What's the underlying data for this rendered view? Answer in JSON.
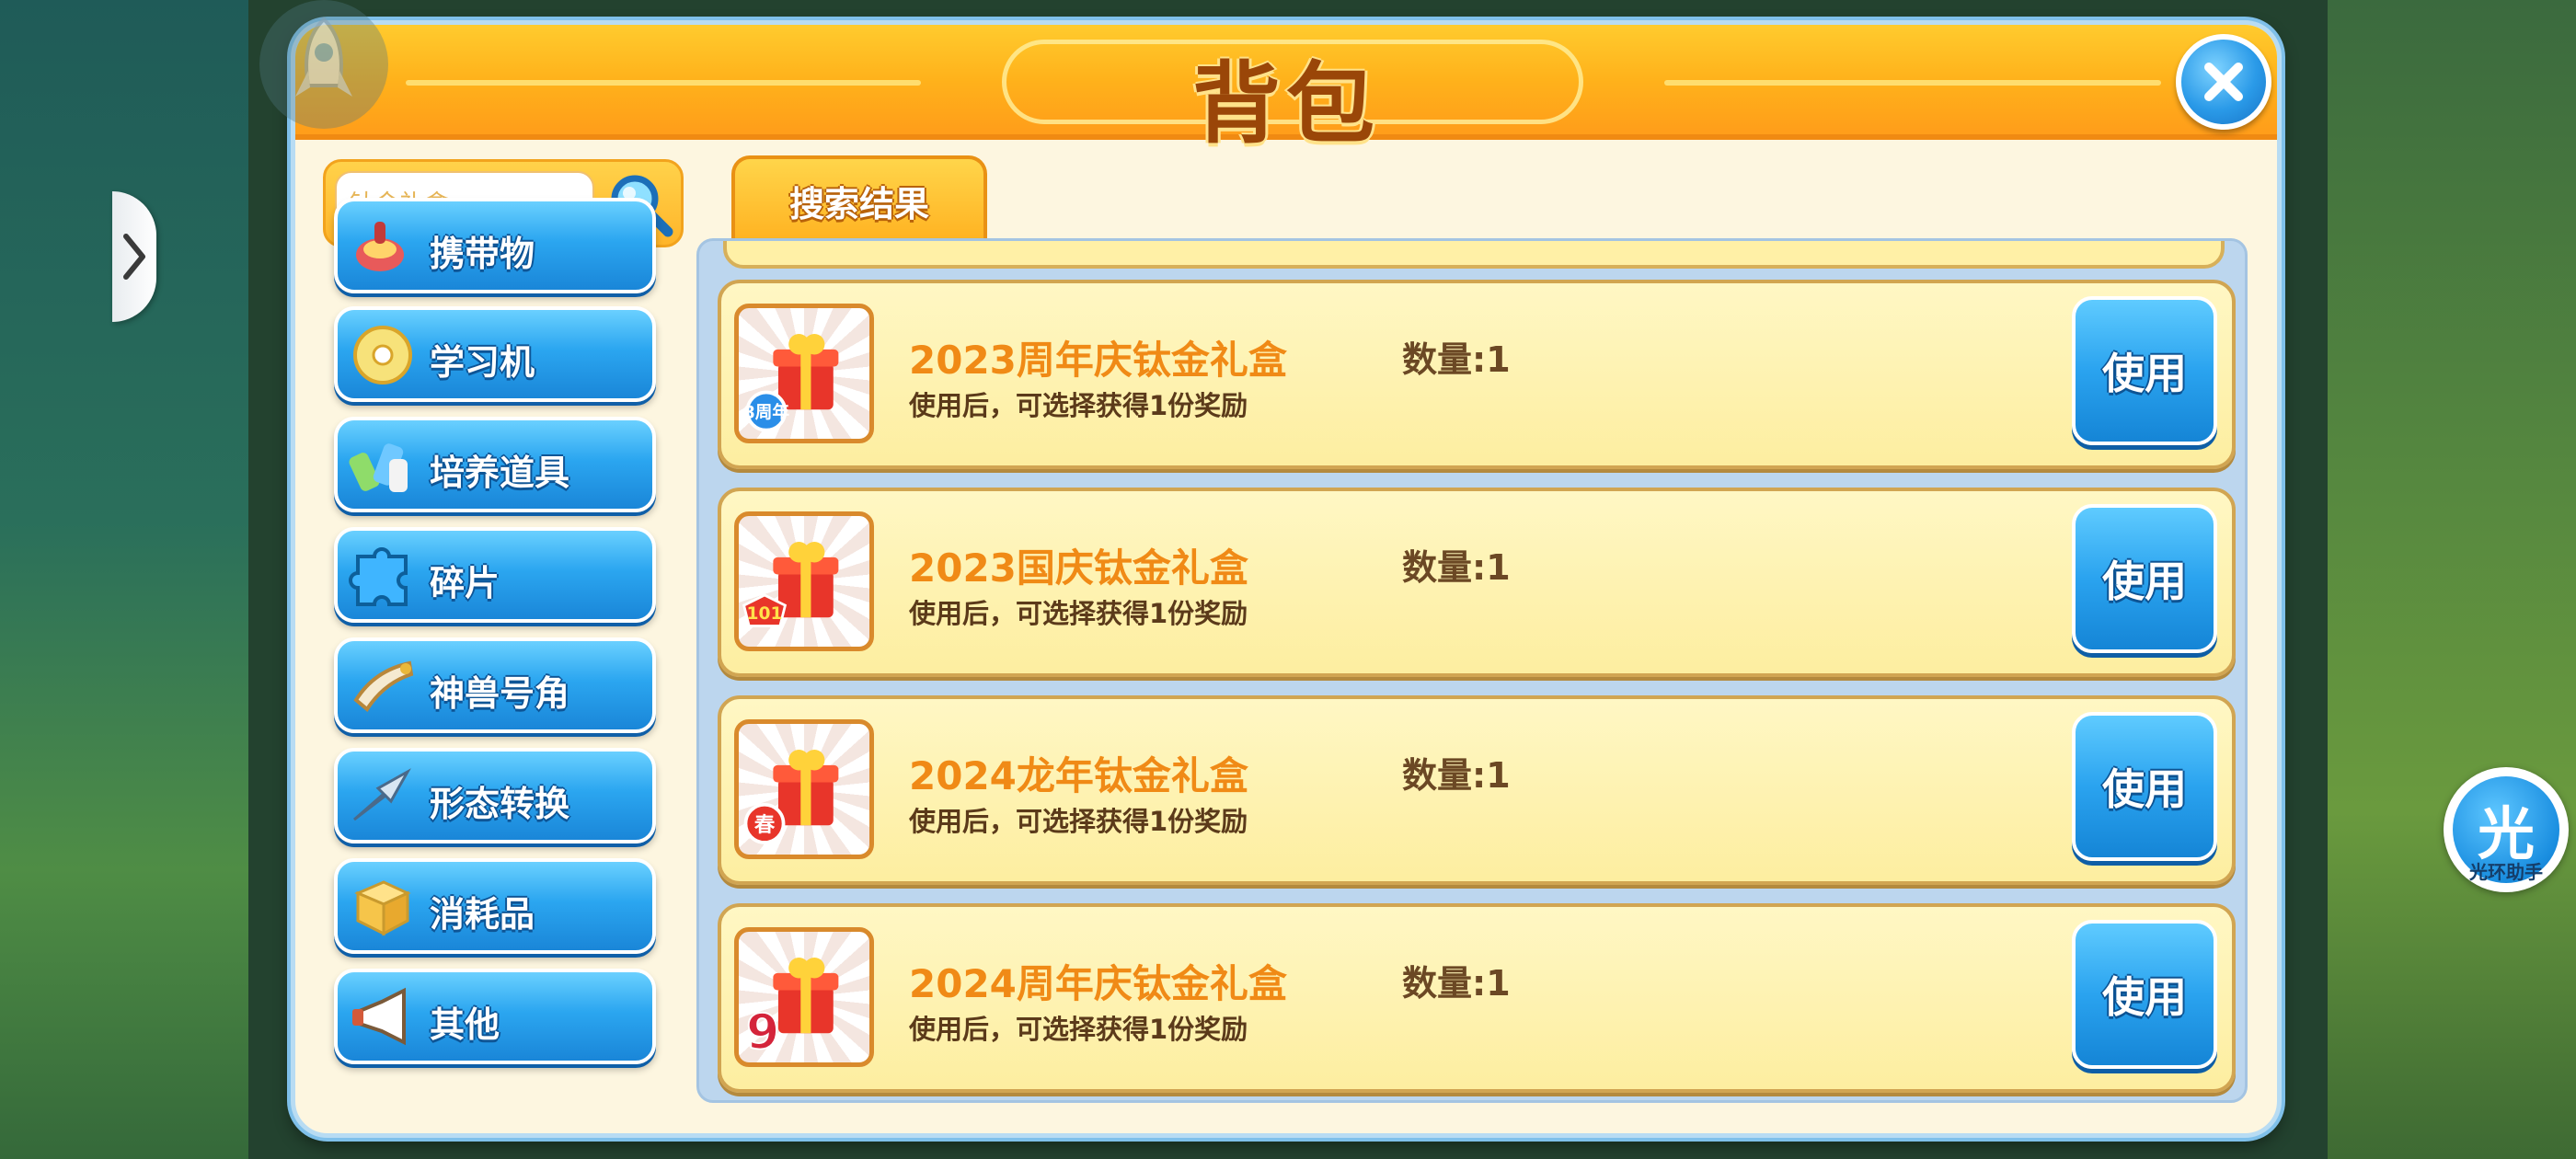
{
  "window": {
    "title": "背包"
  },
  "colors": {
    "title_bar": "#ffb21b",
    "panel_bg": "#fdf6e0",
    "category_button": "#2ba6f0",
    "item_name": "#f08a16",
    "use_button": "#2aa3ef"
  },
  "search": {
    "placeholder": "钛金礼盒",
    "value": ""
  },
  "sidebar": {
    "categories": [
      {
        "label": "携带物",
        "icon": "carry-item-icon"
      },
      {
        "label": "学习机",
        "icon": "disc-icon"
      },
      {
        "label": "培养道具",
        "icon": "potion-icon"
      },
      {
        "label": "碎片",
        "icon": "puzzle-piece-icon"
      },
      {
        "label": "神兽号角",
        "icon": "horn-icon"
      },
      {
        "label": "形态转换",
        "icon": "arrow-shift-icon"
      },
      {
        "label": "消耗品",
        "icon": "box-icon"
      },
      {
        "label": "其他",
        "icon": "megaphone-icon"
      }
    ]
  },
  "tabs": [
    {
      "label": "搜索结果",
      "active": true
    }
  ],
  "items": [
    {
      "name": "2023周年庆钛金礼盒",
      "description": "使用后，可选择获得1份奖励",
      "quantity": "数量:1",
      "action": "使用",
      "icon": "gift-box-icon"
    },
    {
      "name": "2023国庆钛金礼盒",
      "description": "使用后，可选择获得1份奖励",
      "quantity": "数量:1",
      "action": "使用",
      "icon": "gift-box-icon"
    },
    {
      "name": "2024龙年钛金礼盒",
      "description": "使用后，可选择获得1份奖励",
      "quantity": "数量:1",
      "action": "使用",
      "icon": "gift-box-icon"
    },
    {
      "name": "2024周年庆钛金礼盒",
      "description": "使用后，可选择获得1份奖励",
      "quantity": "数量:1",
      "action": "使用",
      "icon": "gift-box-icon"
    }
  ],
  "item_badges": [
    "8周年",
    "101",
    "春",
    "9"
  ],
  "assistant": {
    "glyph": "光",
    "label": "光环助手"
  }
}
